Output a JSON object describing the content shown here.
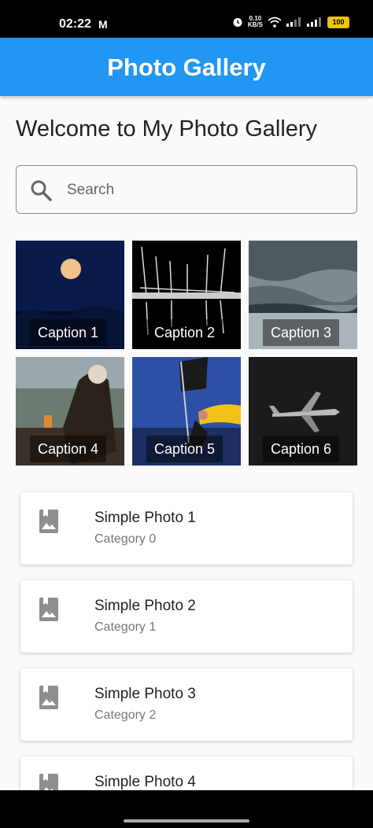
{
  "status": {
    "time": "02:22",
    "mail_icon": "gmail-icon",
    "speed_value": "0.10",
    "speed_unit": "KB/S",
    "battery": "100"
  },
  "app_bar": {
    "title": "Photo Gallery"
  },
  "welcome": "Welcome to My Photo Gallery",
  "search": {
    "placeholder": "Search",
    "value": ""
  },
  "gallery": [
    {
      "caption": "Caption 1",
      "icon": "moon-photo"
    },
    {
      "caption": "Caption 2",
      "icon": "sailboats-photo"
    },
    {
      "caption": "Caption 3",
      "icon": "cloudy-lake-photo"
    },
    {
      "caption": "Caption 4",
      "icon": "lantern-woman-photo"
    },
    {
      "caption": "Caption 5",
      "icon": "flag-runner-photo"
    },
    {
      "caption": "Caption 6",
      "icon": "airplane-photo"
    }
  ],
  "photos": [
    {
      "title": "Simple Photo 1",
      "category": "Category 0"
    },
    {
      "title": "Simple Photo 2",
      "category": "Category 1"
    },
    {
      "title": "Simple Photo 3",
      "category": "Category 2"
    },
    {
      "title": "Simple Photo 4",
      "category": ""
    }
  ],
  "colors": {
    "app_bar": "#2196f3",
    "background": "#fafafa",
    "card_icon": "#8e8e8e"
  }
}
